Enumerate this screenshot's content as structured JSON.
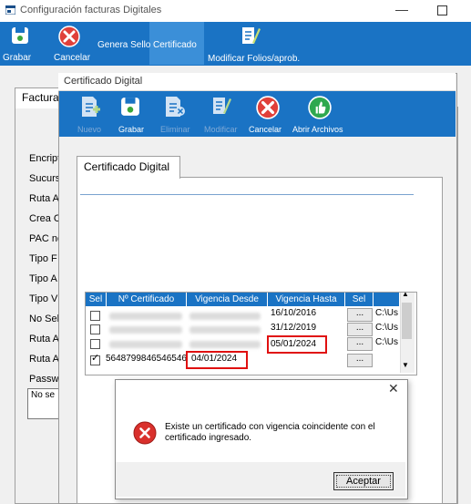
{
  "main_window": {
    "title": "Configuración facturas Digitales",
    "minimize_glyph": "—",
    "toolbar": {
      "grabar": "Grabar",
      "cancelar": "Cancelar",
      "genera_sello": "Genera Sello",
      "certificado": "Certificado",
      "modificar_folios": "Modificar Folios/aprob."
    },
    "tab_label": "Factura",
    "field_labels": [
      "Encript",
      "Sucurs",
      "Ruta A",
      "Crea C",
      "PAC no",
      "Tipo F",
      "Tipo A",
      "Tipo V",
      "No Sell",
      "Ruta A",
      "Ruta A",
      "Passw"
    ],
    "textbox_text": "No se"
  },
  "cert_window": {
    "title": "Certificado Digital",
    "toolbar": {
      "nuevo": "Nuevo",
      "grabar": "Grabar",
      "eliminar": "Eliminar",
      "modificar": "Modificar",
      "cancelar": "Cancelar",
      "abrir_archivos": "Abrir Archivos"
    },
    "tab_label": "Certificado Digital",
    "grid": {
      "columns": [
        "Sel",
        "Nº Certificado",
        "Vigencia Desde",
        "Vigencia Hasta",
        "Sel"
      ],
      "rows": [
        {
          "checked": false,
          "numero": "",
          "desde": "",
          "hasta": "16/10/2016",
          "button": "...",
          "path": "C:\\Us"
        },
        {
          "checked": false,
          "numero": "",
          "desde": "",
          "hasta": "31/12/2019",
          "button": "...",
          "path": "C:\\Us"
        },
        {
          "checked": false,
          "numero": "",
          "desde": "",
          "hasta": "05/01/2024",
          "button": "...",
          "path": "C:\\Us"
        },
        {
          "checked": true,
          "numero": "5648799846546546",
          "desde": "04/01/2024",
          "hasta": "",
          "button": "...",
          "path": ""
        }
      ]
    }
  },
  "message_box": {
    "close_glyph": "✕",
    "text": "Existe un certificado con vigencia coincidente con el certificado ingresado.",
    "ok_button": "Aceptar"
  },
  "colors": {
    "toolbar_blue": "#1a73c4",
    "highlight_red": "#e01010",
    "error_red": "#d9302c"
  }
}
